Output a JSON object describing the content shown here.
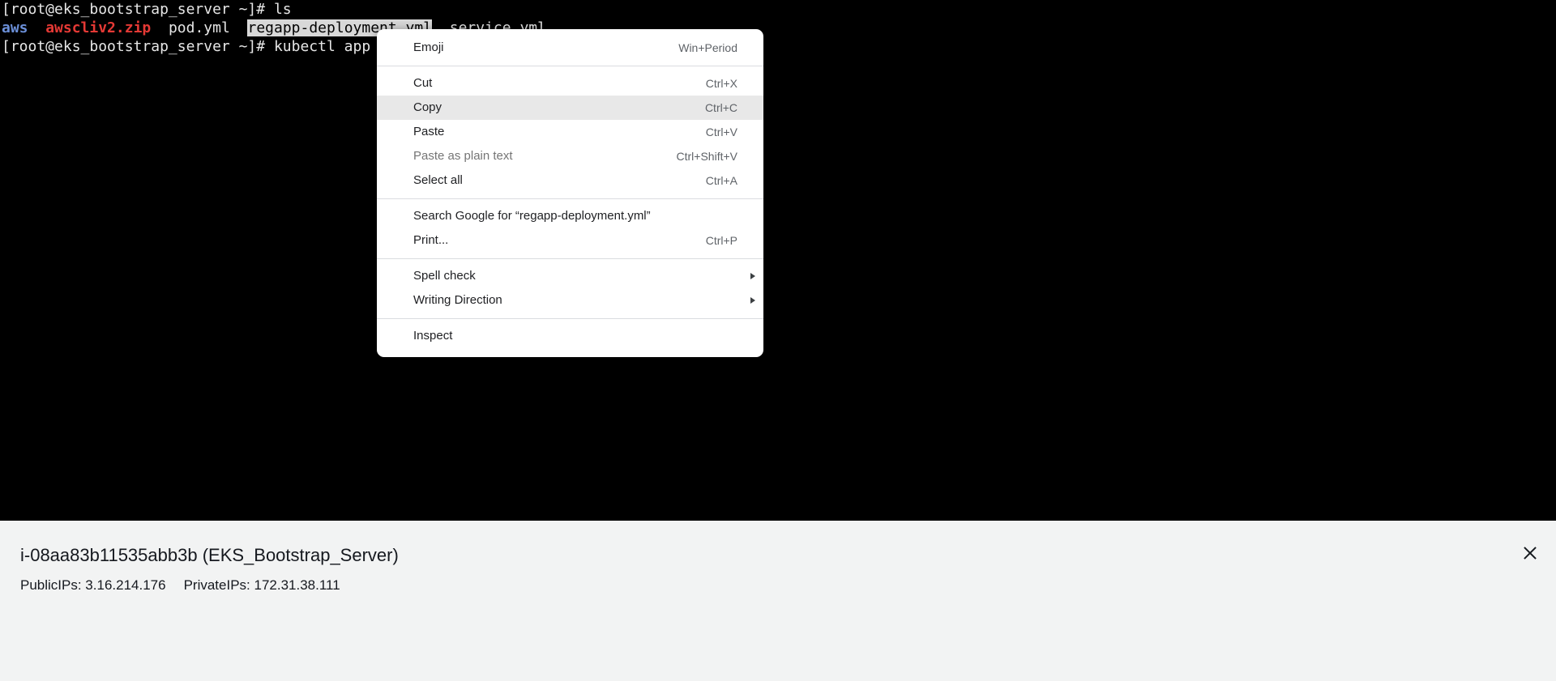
{
  "terminal": {
    "line1": "[root@eks_bootstrap_server ~]# ls",
    "line2": {
      "aws_dir": "aws",
      "sep1": "  ",
      "zip": "awscliv2.zip",
      "sep2": "  ",
      "pod": "pod.yml",
      "sep3": "  ",
      "selected": "regapp-deployment.yml",
      "sep4": "  ",
      "service": "service.yml"
    },
    "line3": "[root@eks_bootstrap_server ~]# kubectl app"
  },
  "context_menu": {
    "emoji": {
      "label": "Emoji",
      "shortcut": "Win+Period"
    },
    "cut": {
      "label": "Cut",
      "shortcut": "Ctrl+X"
    },
    "copy": {
      "label": "Copy",
      "shortcut": "Ctrl+C"
    },
    "paste": {
      "label": "Paste",
      "shortcut": "Ctrl+V"
    },
    "paste_plain": {
      "label": "Paste as plain text",
      "shortcut": "Ctrl+Shift+V"
    },
    "select_all": {
      "label": "Select all",
      "shortcut": "Ctrl+A"
    },
    "search_google": {
      "label": "Search Google for “regapp-deployment.yml”"
    },
    "print": {
      "label": "Print...",
      "shortcut": "Ctrl+P"
    },
    "spell_check": {
      "label": "Spell check"
    },
    "writing_direction": {
      "label": "Writing Direction"
    },
    "inspect": {
      "label": "Inspect"
    }
  },
  "info_panel": {
    "title": "i-08aa83b11535abb3b (EKS_Bootstrap_Server)",
    "public_ips": "PublicIPs: 3.16.214.176",
    "private_ips": "PrivateIPs: 172.31.38.111",
    "close_icon": "close-icon"
  },
  "colors": {
    "terminal_bg": "#000000",
    "dir_color": "#6b8fd8",
    "zip_color": "#e53935",
    "panel_bg": "#f2f3f3"
  }
}
